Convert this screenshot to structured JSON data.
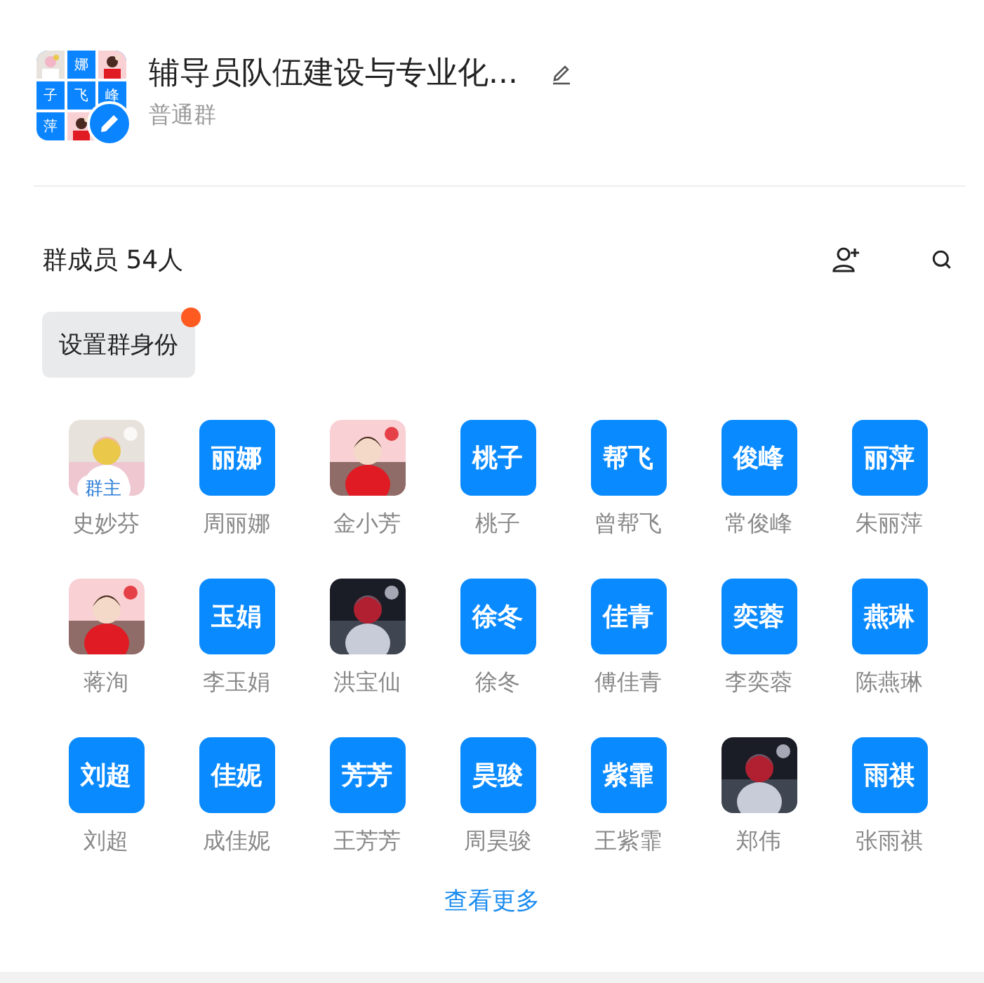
{
  "group": {
    "avatar_tiles": [
      {
        "kind": "picture"
      },
      {
        "kind": "text",
        "text": "娜"
      },
      {
        "kind": "picture"
      },
      {
        "kind": "text",
        "text": "子"
      },
      {
        "kind": "text",
        "text": "飞"
      },
      {
        "kind": "text",
        "text": "峰"
      },
      {
        "kind": "text",
        "text": "萍"
      },
      {
        "kind": "picture"
      }
    ],
    "title": "辅导员队伍建设与专业化...",
    "type": "普通群"
  },
  "members_header": {
    "title": "群成员 54人"
  },
  "role_button": {
    "label": "设置群身份",
    "notification": true
  },
  "members": [
    {
      "name": "史妙芬",
      "avatar": {
        "kind": "picture"
      },
      "badge": "群主"
    },
    {
      "name": "周丽娜",
      "avatar": {
        "kind": "text",
        "text": "丽娜"
      }
    },
    {
      "name": "金小芳",
      "avatar": {
        "kind": "picture"
      }
    },
    {
      "name": "桃子",
      "avatar": {
        "kind": "text",
        "text": "桃子"
      }
    },
    {
      "name": "曾帮飞",
      "avatar": {
        "kind": "text",
        "text": "帮飞"
      }
    },
    {
      "name": "常俊峰",
      "avatar": {
        "kind": "text",
        "text": "俊峰"
      }
    },
    {
      "name": "朱丽萍",
      "avatar": {
        "kind": "text",
        "text": "丽萍"
      }
    },
    {
      "name": "蒋洵",
      "avatar": {
        "kind": "picture"
      }
    },
    {
      "name": "李玉娟",
      "avatar": {
        "kind": "text",
        "text": "玉娟"
      }
    },
    {
      "name": "洪宝仙",
      "avatar": {
        "kind": "picture"
      }
    },
    {
      "name": "徐冬",
      "avatar": {
        "kind": "text",
        "text": "徐冬"
      }
    },
    {
      "name": "傅佳青",
      "avatar": {
        "kind": "text",
        "text": "佳青"
      }
    },
    {
      "name": "李奕蓉",
      "avatar": {
        "kind": "text",
        "text": "奕蓉"
      }
    },
    {
      "name": "陈燕琳",
      "avatar": {
        "kind": "text",
        "text": "燕琳"
      }
    },
    {
      "name": "刘超",
      "avatar": {
        "kind": "text",
        "text": "刘超"
      }
    },
    {
      "name": "成佳妮",
      "avatar": {
        "kind": "text",
        "text": "佳妮"
      }
    },
    {
      "name": "王芳芳",
      "avatar": {
        "kind": "text",
        "text": "芳芳"
      }
    },
    {
      "name": "周昊骏",
      "avatar": {
        "kind": "text",
        "text": "昊骏"
      }
    },
    {
      "name": "王紫霏",
      "avatar": {
        "kind": "text",
        "text": "紫霏"
      }
    },
    {
      "name": "郑伟",
      "avatar": {
        "kind": "picture"
      }
    },
    {
      "name": "张雨祺",
      "avatar": {
        "kind": "text",
        "text": "雨祺"
      }
    }
  ],
  "more_link": "查看更多"
}
